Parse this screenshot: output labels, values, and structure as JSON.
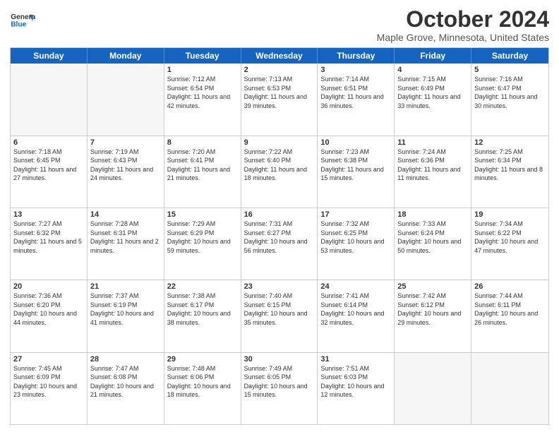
{
  "header": {
    "logo_line1": "General",
    "logo_line2": "Blue",
    "month_title": "October 2024",
    "location": "Maple Grove, Minnesota, United States"
  },
  "days_of_week": [
    "Sunday",
    "Monday",
    "Tuesday",
    "Wednesday",
    "Thursday",
    "Friday",
    "Saturday"
  ],
  "weeks": [
    [
      {
        "day": "",
        "empty": true
      },
      {
        "day": "",
        "empty": true
      },
      {
        "day": "1",
        "sunrise": "7:12 AM",
        "sunset": "6:54 PM",
        "daylight": "11 hours and 42 minutes."
      },
      {
        "day": "2",
        "sunrise": "7:13 AM",
        "sunset": "6:53 PM",
        "daylight": "11 hours and 39 minutes."
      },
      {
        "day": "3",
        "sunrise": "7:14 AM",
        "sunset": "6:51 PM",
        "daylight": "11 hours and 36 minutes."
      },
      {
        "day": "4",
        "sunrise": "7:15 AM",
        "sunset": "6:49 PM",
        "daylight": "11 hours and 33 minutes."
      },
      {
        "day": "5",
        "sunrise": "7:16 AM",
        "sunset": "6:47 PM",
        "daylight": "11 hours and 30 minutes."
      }
    ],
    [
      {
        "day": "6",
        "sunrise": "7:18 AM",
        "sunset": "6:45 PM",
        "daylight": "11 hours and 27 minutes."
      },
      {
        "day": "7",
        "sunrise": "7:19 AM",
        "sunset": "6:43 PM",
        "daylight": "11 hours and 24 minutes."
      },
      {
        "day": "8",
        "sunrise": "7:20 AM",
        "sunset": "6:41 PM",
        "daylight": "11 hours and 21 minutes."
      },
      {
        "day": "9",
        "sunrise": "7:22 AM",
        "sunset": "6:40 PM",
        "daylight": "11 hours and 18 minutes."
      },
      {
        "day": "10",
        "sunrise": "7:23 AM",
        "sunset": "6:38 PM",
        "daylight": "11 hours and 15 minutes."
      },
      {
        "day": "11",
        "sunrise": "7:24 AM",
        "sunset": "6:36 PM",
        "daylight": "11 hours and 11 minutes."
      },
      {
        "day": "12",
        "sunrise": "7:25 AM",
        "sunset": "6:34 PM",
        "daylight": "11 hours and 8 minutes."
      }
    ],
    [
      {
        "day": "13",
        "sunrise": "7:27 AM",
        "sunset": "6:32 PM",
        "daylight": "11 hours and 5 minutes."
      },
      {
        "day": "14",
        "sunrise": "7:28 AM",
        "sunset": "6:31 PM",
        "daylight": "11 hours and 2 minutes."
      },
      {
        "day": "15",
        "sunrise": "7:29 AM",
        "sunset": "6:29 PM",
        "daylight": "10 hours and 59 minutes."
      },
      {
        "day": "16",
        "sunrise": "7:31 AM",
        "sunset": "6:27 PM",
        "daylight": "10 hours and 56 minutes."
      },
      {
        "day": "17",
        "sunrise": "7:32 AM",
        "sunset": "6:25 PM",
        "daylight": "10 hours and 53 minutes."
      },
      {
        "day": "18",
        "sunrise": "7:33 AM",
        "sunset": "6:24 PM",
        "daylight": "10 hours and 50 minutes."
      },
      {
        "day": "19",
        "sunrise": "7:34 AM",
        "sunset": "6:22 PM",
        "daylight": "10 hours and 47 minutes."
      }
    ],
    [
      {
        "day": "20",
        "sunrise": "7:36 AM",
        "sunset": "6:20 PM",
        "daylight": "10 hours and 44 minutes."
      },
      {
        "day": "21",
        "sunrise": "7:37 AM",
        "sunset": "6:19 PM",
        "daylight": "10 hours and 41 minutes."
      },
      {
        "day": "22",
        "sunrise": "7:38 AM",
        "sunset": "6:17 PM",
        "daylight": "10 hours and 38 minutes."
      },
      {
        "day": "23",
        "sunrise": "7:40 AM",
        "sunset": "6:15 PM",
        "daylight": "10 hours and 35 minutes."
      },
      {
        "day": "24",
        "sunrise": "7:41 AM",
        "sunset": "6:14 PM",
        "daylight": "10 hours and 32 minutes."
      },
      {
        "day": "25",
        "sunrise": "7:42 AM",
        "sunset": "6:12 PM",
        "daylight": "10 hours and 29 minutes."
      },
      {
        "day": "26",
        "sunrise": "7:44 AM",
        "sunset": "6:11 PM",
        "daylight": "10 hours and 26 minutes."
      }
    ],
    [
      {
        "day": "27",
        "sunrise": "7:45 AM",
        "sunset": "6:09 PM",
        "daylight": "10 hours and 23 minutes."
      },
      {
        "day": "28",
        "sunrise": "7:47 AM",
        "sunset": "6:08 PM",
        "daylight": "10 hours and 21 minutes."
      },
      {
        "day": "29",
        "sunrise": "7:48 AM",
        "sunset": "6:06 PM",
        "daylight": "10 hours and 18 minutes."
      },
      {
        "day": "30",
        "sunrise": "7:49 AM",
        "sunset": "6:05 PM",
        "daylight": "10 hours and 15 minutes."
      },
      {
        "day": "31",
        "sunrise": "7:51 AM",
        "sunset": "6:03 PM",
        "daylight": "10 hours and 12 minutes."
      },
      {
        "day": "",
        "empty": true
      },
      {
        "day": "",
        "empty": true
      }
    ]
  ]
}
